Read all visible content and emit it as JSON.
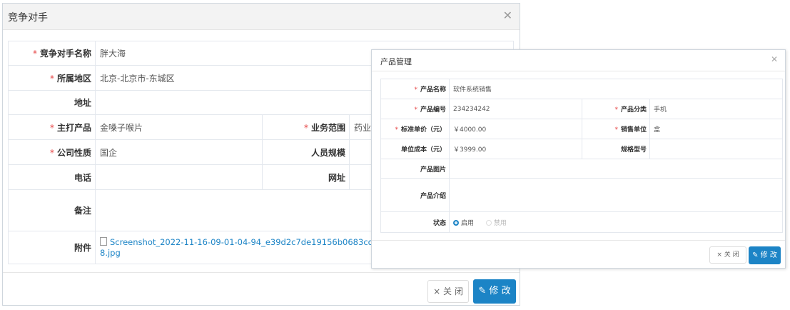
{
  "competitor_dialog": {
    "title": "竞争对手",
    "close_glyph": "✕",
    "fields": {
      "name": {
        "label": "竞争对手名称",
        "value": "胖大海",
        "required": "*"
      },
      "region": {
        "label": "所属地区",
        "value": "北京-北京市-东城区",
        "required": "*"
      },
      "address": {
        "label": "地址",
        "value": ""
      },
      "main_product": {
        "label": "主打产品",
        "value": "金嗓子喉片",
        "required": "*"
      },
      "business_scope": {
        "label": "业务范围",
        "value": "药业",
        "required": "*"
      },
      "company_type": {
        "label": "公司性质",
        "value": "国企",
        "required": "*"
      },
      "staff_size": {
        "label": "人员规模",
        "value": ""
      },
      "phone": {
        "label": "电话",
        "value": ""
      },
      "website": {
        "label": "网址",
        "value": ""
      },
      "remark": {
        "label": "备注",
        "value": ""
      },
      "attachment": {
        "label": "附件",
        "value": "Screenshot_2022-11-16-09-01-04-94_e39d2c7de19156b0683cd93e8735f3",
        "value_line2": "8.jpg"
      }
    },
    "buttons": {
      "close": "× 关 闭",
      "edit": "✎ 修 改"
    }
  },
  "product_dialog": {
    "title": "产品管理",
    "close_glyph": "✕",
    "fields": {
      "product_name": {
        "label": "产品名称",
        "value": "软件系统销售",
        "required": "*"
      },
      "product_code": {
        "label": "产品编号",
        "value": "234234242",
        "required": "*"
      },
      "category": {
        "label": "产品分类",
        "value": "手机",
        "required": "*"
      },
      "unit_price": {
        "label": "标准单价（元）",
        "value": "￥4000.00",
        "required": "*"
      },
      "sales_unit": {
        "label": "销售单位",
        "value": "盒",
        "required": "*"
      },
      "unit_cost": {
        "label": "单位成本（元）",
        "value": "￥3999.00"
      },
      "spec_model": {
        "label": "规格型号",
        "value": ""
      },
      "image": {
        "label": "产品图片",
        "value": ""
      },
      "intro": {
        "label": "产品介绍",
        "value": ""
      },
      "status": {
        "label": "状态",
        "options": [
          "启用",
          "禁用"
        ],
        "selected": "启用"
      }
    },
    "buttons": {
      "close": "× 关 闭",
      "edit": "✎ 修 改"
    }
  },
  "colors": {
    "primary": "#1c84c6",
    "required": "#e64545",
    "border": "#e4e8ee"
  }
}
